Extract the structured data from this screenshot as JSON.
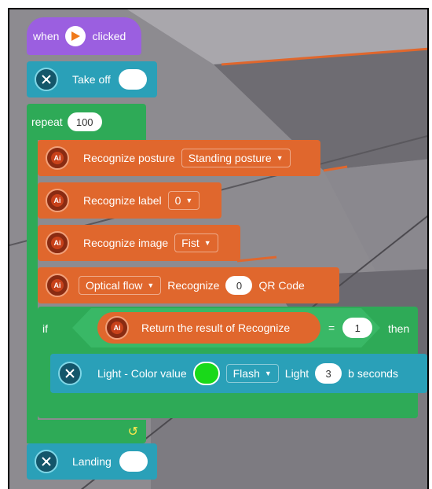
{
  "hat": {
    "when": "when",
    "clicked": "clicked"
  },
  "takeoff": {
    "label": "Take off"
  },
  "repeat": {
    "label": "repeat",
    "count": "100"
  },
  "posture": {
    "label": "Recognize posture",
    "option": "Standing posture"
  },
  "label_block": {
    "label": "Recognize label",
    "option": "0"
  },
  "image_block": {
    "label": "Recognize image",
    "option": "Fist"
  },
  "optical": {
    "option": "Optical flow",
    "label": "Recognize",
    "value": "0",
    "suffix": "QR Code"
  },
  "if_block": {
    "if": "if",
    "result_label": "Return the result of Recognize",
    "op": "=",
    "value": "1",
    "then": "then"
  },
  "light": {
    "label": "Light - Color value",
    "mode": "Flash",
    "light": "Light",
    "seconds_value": "3",
    "seconds": "b seconds",
    "color": "#19d919"
  },
  "landing": {
    "label": "Landing"
  },
  "icons": {
    "ai": "Ai"
  },
  "colors": {
    "purple": "#9b5fe0",
    "teal": "#2aa0b8",
    "green": "#2eaa57",
    "orange": "#e0672d"
  }
}
